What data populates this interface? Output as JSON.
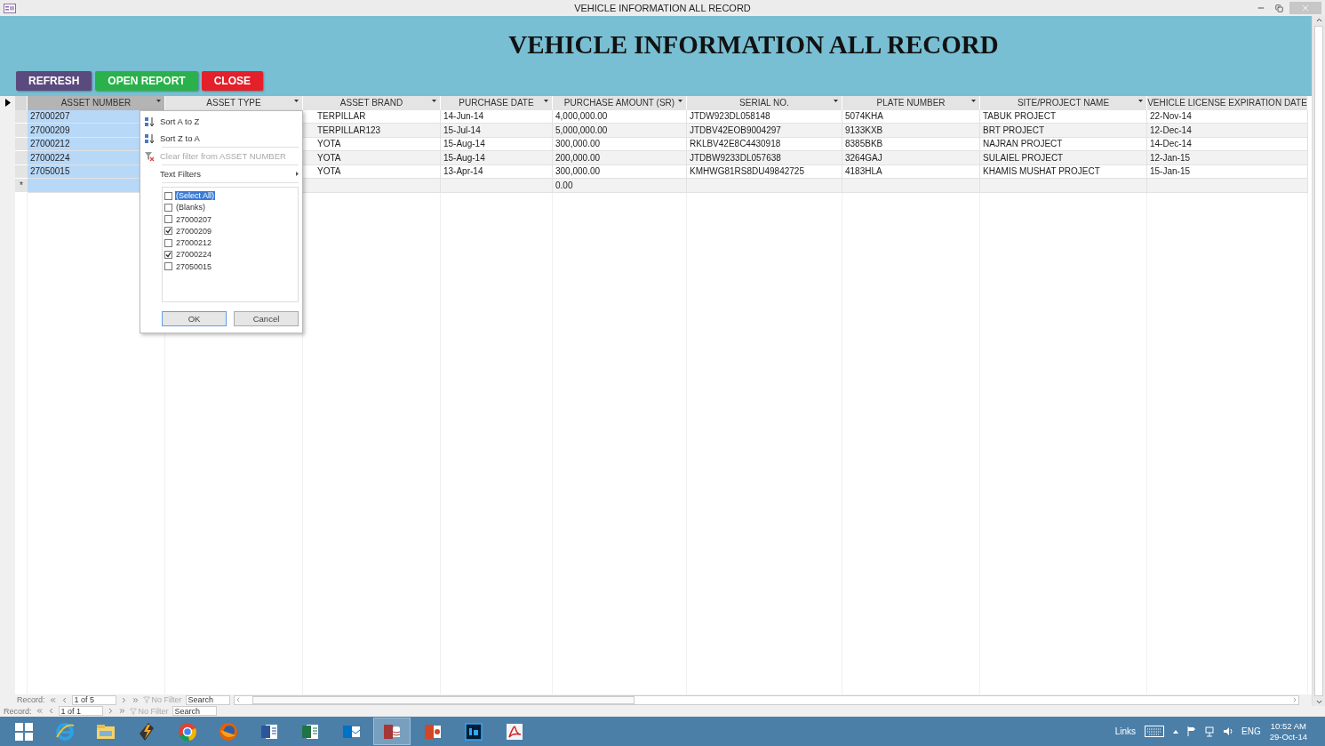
{
  "window": {
    "title": "VEHICLE INFORMATION ALL RECORD"
  },
  "header": {
    "title": "VEHICLE INFORMATION ALL RECORD",
    "buttons": [
      {
        "label": "REFRESH",
        "color": "#5b4a7d"
      },
      {
        "label": "OPEN REPORT",
        "color": "#2ab14b"
      },
      {
        "label": "CLOSE",
        "color": "#e4202a"
      }
    ]
  },
  "table": {
    "columns": [
      {
        "label": "ASSET NUMBER",
        "selected": true,
        "dropdown": true
      },
      {
        "label": "ASSET TYPE",
        "selected": false,
        "dropdown": true
      },
      {
        "label": "ASSET BRAND",
        "selected": false,
        "dropdown": true
      },
      {
        "label": "PURCHASE DATE",
        "selected": false,
        "dropdown": true
      },
      {
        "label": "PURCHASE AMOUNT (SR)",
        "selected": false,
        "dropdown": true
      },
      {
        "label": "SERIAL NO.",
        "selected": false,
        "dropdown": true
      },
      {
        "label": "PLATE NUMBER",
        "selected": false,
        "dropdown": true
      },
      {
        "label": "SITE/PROJECT  NAME",
        "selected": false,
        "dropdown": true
      },
      {
        "label": "VEHICLE LICENSE EXPIRATION DATE",
        "selected": false,
        "dropdown": false
      }
    ],
    "rows": [
      [
        "27000207",
        null,
        "TERPILLAR",
        "14-Jun-14",
        "4,000,000.00",
        "JTDW923DL058148",
        "5074KHA",
        "TABUK PROJECT",
        "22-Nov-14"
      ],
      [
        "27000209",
        null,
        "TERPILLAR123",
        "15-Jul-14",
        "5,000,000.00",
        "JTDBV42EOB9004297",
        "9133KXB",
        "BRT PROJECT",
        "12-Dec-14"
      ],
      [
        "27000212",
        null,
        "YOTA",
        "15-Aug-14",
        "300,000.00",
        "RKLBV42E8C4430918",
        "8385BKB",
        "NAJRAN PROJECT",
        "14-Dec-14"
      ],
      [
        "27000224",
        null,
        "YOTA",
        "15-Aug-14",
        "200,000.00",
        "JTDBW9233DL057638",
        "3264GAJ",
        "SULAIEL PROJECT",
        "12-Jan-15"
      ],
      [
        "27050015",
        null,
        "YOTA",
        "13-Apr-14",
        "300,000.00",
        "KMHWG81RS8DU49842725",
        "4183HLA",
        "KHAMIS MUSHAT PROJECT",
        "15-Jan-15"
      ]
    ],
    "new_row": {
      "marker": "*",
      "cells": [
        null,
        null,
        null,
        null,
        "0.00",
        null,
        null,
        null,
        null
      ]
    }
  },
  "filter_menu": {
    "items": [
      {
        "kind": "sort-az",
        "label": "Sort A to Z",
        "disabled": false
      },
      {
        "kind": "sort-za",
        "label": "Sort Z to A",
        "disabled": false
      },
      {
        "kind": "clear",
        "label": "Clear filter from ASSET NUMBER",
        "disabled": true
      },
      {
        "kind": "submenu",
        "label": "Text Filters",
        "disabled": false
      }
    ],
    "values": [
      {
        "label": "(Select All)",
        "checked": false,
        "selected": true
      },
      {
        "label": "(Blanks)",
        "checked": false,
        "selected": false
      },
      {
        "label": "27000207",
        "checked": false,
        "selected": false
      },
      {
        "label": "27000209",
        "checked": true,
        "selected": false
      },
      {
        "label": "27000212",
        "checked": false,
        "selected": false
      },
      {
        "label": "27000224",
        "checked": true,
        "selected": false
      },
      {
        "label": "27050015",
        "checked": false,
        "selected": false
      }
    ],
    "buttons": [
      "OK",
      "Cancel"
    ]
  },
  "nav_bars": [
    {
      "label": "Record:",
      "position": "1 of 5",
      "filter": "No Filter",
      "search": "Search"
    },
    {
      "label": "Record:",
      "position": "1 of 1",
      "filter": "No Filter",
      "search": "Search"
    }
  ],
  "taskbar": {
    "apps": [
      {
        "kind": "ie",
        "selected": false
      },
      {
        "kind": "folder",
        "selected": false
      },
      {
        "kind": "bolt",
        "selected": false
      },
      {
        "kind": "chrome",
        "selected": false
      },
      {
        "kind": "firefox",
        "selected": false
      },
      {
        "kind": "word",
        "selected": false
      },
      {
        "kind": "excel",
        "selected": false
      },
      {
        "kind": "outlook",
        "selected": false
      },
      {
        "kind": "access",
        "selected": true
      },
      {
        "kind": "powerpoint",
        "selected": false
      },
      {
        "kind": "photoshop",
        "selected": false
      },
      {
        "kind": "acrobat",
        "selected": false
      }
    ],
    "links": "Links",
    "language": "ENG",
    "time": "10:52 AM",
    "date": "29-Oct-14"
  }
}
